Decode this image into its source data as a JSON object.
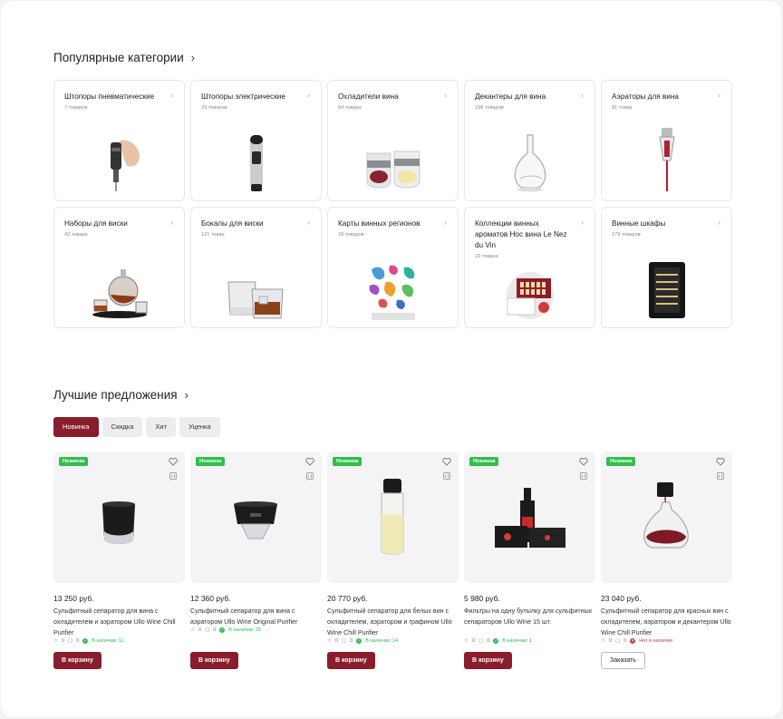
{
  "categories_section": {
    "title": "Популярные категории",
    "chevron": "›",
    "items": [
      {
        "name": "Штопоры пневматические",
        "count": "7 товаров",
        "icon": "pneumatic-corkscrew-image"
      },
      {
        "name": "Штопоры электрические",
        "count": "29 товаров",
        "icon": "electric-corkscrew-image"
      },
      {
        "name": "Охладители вина",
        "count": "64 товара",
        "icon": "wine-cooler-glasses-image"
      },
      {
        "name": "Декантеры для вина",
        "count": "198 товаров",
        "icon": "decanter-image"
      },
      {
        "name": "Аэраторы для вина",
        "count": "81 товар",
        "icon": "aerator-image"
      },
      {
        "name": "Наборы для виски",
        "count": "42 товара",
        "icon": "whisky-set-image"
      },
      {
        "name": "Бокалы для виски",
        "count": "121 товар",
        "icon": "whisky-glasses-image"
      },
      {
        "name": "Карты винных регионов",
        "count": "18 товаров",
        "icon": "wine-map-image"
      },
      {
        "name": "Коллекции винных ароматов Нос вина Le Nez du Vin",
        "count": "23 товара",
        "icon": "aroma-kit-image"
      },
      {
        "name": "Винные шкафы",
        "count": "179 товаров",
        "icon": "wine-cabinet-image"
      }
    ]
  },
  "offers_section": {
    "title": "Лучшие предложения",
    "chevron": "›",
    "tabs": [
      "Новинка",
      "Скидка",
      "Хит",
      "Уценка"
    ],
    "active_tab": "Новинка"
  },
  "products": [
    {
      "badge": "Новинка",
      "price": "13 250 руб.",
      "title": "Сульфитный сепаратор для вина с охладителем и аэратором Ullo Wine Chill Purifier",
      "rating": "0",
      "reviews": "0",
      "stock": "В наличии: 11",
      "in_stock": true,
      "button": "В корзину"
    },
    {
      "badge": "Новинка",
      "price": "12 360 руб.",
      "title": "Сульфитный сепаратор для вина с аэратором Ullo Wine Original Purifier",
      "rating": "0",
      "reviews": "0",
      "stock": "В наличии: 25",
      "in_stock": true,
      "button": "В корзину"
    },
    {
      "badge": "Новинка",
      "price": "20 770 руб.",
      "title": "Сульфитный сепаратор для белых вин с охладителем, аэратором и графином Ullo Wine Chill Purifier",
      "rating": "0",
      "reviews": "0",
      "stock": "В наличии: 14",
      "in_stock": true,
      "button": "В корзину"
    },
    {
      "badge": "Новинка",
      "price": "5 980 руб.",
      "title": "Фильтры на одну бутылку для сульфитных сепараторов Ullo Wine 15 шт.",
      "rating": "0",
      "reviews": "0",
      "stock": "В наличии: 1",
      "in_stock": true,
      "button": "В корзину"
    },
    {
      "badge": "Новинка",
      "price": "23 040 руб.",
      "title": "Сульфитный сепаратор для красных вин с охладителем, аэратором и декантером Ullo Wine Chill Purifier",
      "rating": "0",
      "reviews": "0",
      "stock": "Нет в наличии",
      "in_stock": false,
      "button": "Заказать"
    }
  ],
  "colors": {
    "accent": "#8a1d2c",
    "badge": "#2fbf4a",
    "out_of_stock": "#d23a3a"
  }
}
